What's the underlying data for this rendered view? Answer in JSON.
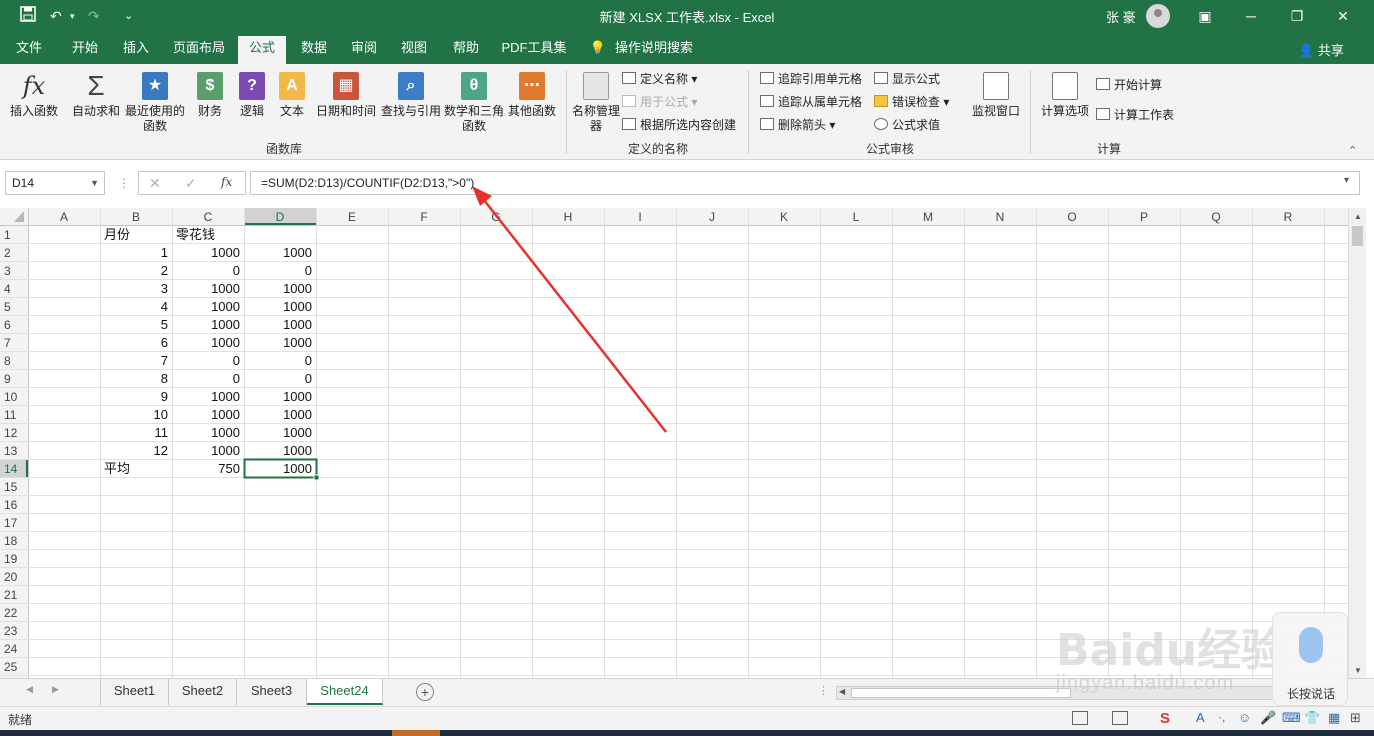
{
  "titlebar": {
    "title": "新建 XLSX 工作表.xlsx  -  Excel",
    "user": "张 豪"
  },
  "menu": {
    "tabs": [
      "文件",
      "开始",
      "插入",
      "页面布局",
      "公式",
      "数据",
      "审阅",
      "视图",
      "帮助",
      "PDF工具集",
      "操作说明搜索"
    ],
    "active": "公式",
    "share": "共享"
  },
  "ribbon": {
    "insert_function": "插入函数",
    "buttons": [
      "自动求和",
      "最近使用的函数",
      "财务",
      "逻辑",
      "文本",
      "日期和时间",
      "查找与引用",
      "数学和三角函数",
      "其他函数"
    ],
    "group_library": "函数库",
    "name_manager": "名称管理器",
    "define_name": "定义名称",
    "use_in_formula": "用于公式",
    "create_from_selection": "根据所选内容创建",
    "group_names": "定义的名称",
    "trace_precedents": "追踪引用单元格",
    "trace_dependents": "追踪从属单元格",
    "remove_arrows": "删除箭头",
    "show_formulas": "显示公式",
    "error_checking": "错误检查",
    "evaluate_formula": "公式求值",
    "watch_window": "监视窗口",
    "group_audit": "公式审核",
    "calc_options": "计算选项",
    "calc_now": "开始计算",
    "calc_sheet": "计算工作表",
    "group_calc": "计算"
  },
  "formula_bar": {
    "name_box": "D14",
    "formula": "=SUM(D2:D13)/COUNTIF(D2:D13,\">0\")",
    "fx_label": "fx"
  },
  "sheet": {
    "columns": [
      "A",
      "B",
      "C",
      "D",
      "E",
      "F",
      "G",
      "H",
      "I",
      "J",
      "K",
      "L",
      "M",
      "N",
      "O",
      "P",
      "Q",
      "R"
    ],
    "row_count": 25,
    "selected": "D14",
    "cells": [
      [
        "",
        "月份",
        "零花钱",
        ""
      ],
      [
        "",
        "1",
        "1000",
        "1000"
      ],
      [
        "",
        "2",
        "0",
        "0"
      ],
      [
        "",
        "3",
        "1000",
        "1000"
      ],
      [
        "",
        "4",
        "1000",
        "1000"
      ],
      [
        "",
        "5",
        "1000",
        "1000"
      ],
      [
        "",
        "6",
        "1000",
        "1000"
      ],
      [
        "",
        "7",
        "0",
        "0"
      ],
      [
        "",
        "8",
        "0",
        "0"
      ],
      [
        "",
        "9",
        "1000",
        "1000"
      ],
      [
        "",
        "10",
        "1000",
        "1000"
      ],
      [
        "",
        "11",
        "1000",
        "1000"
      ],
      [
        "",
        "12",
        "1000",
        "1000"
      ],
      [
        "",
        "平均",
        "750",
        "1000"
      ]
    ]
  },
  "sheet_tabs": [
    "Sheet1",
    "Sheet2",
    "Sheet3",
    "Sheet24"
  ],
  "active_sheet": "Sheet24",
  "status": {
    "text": "就绪"
  },
  "watermark": {
    "brand": "Baidu经验",
    "url": "jingyan.baidu.com",
    "voice_label": "长按说话"
  },
  "colors": {
    "excel_green": "#217346",
    "arrow_red": "#e8302c"
  }
}
